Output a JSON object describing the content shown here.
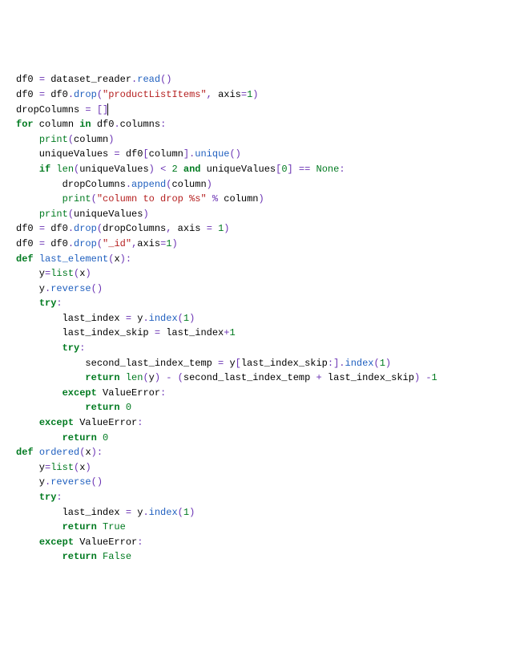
{
  "code": {
    "lines": [
      [
        [
          "nm",
          "df0 "
        ],
        [
          "op",
          "="
        ],
        [
          "nm",
          " dataset_reader"
        ],
        [
          "op",
          "."
        ],
        [
          "fn",
          "read"
        ],
        [
          "op",
          "()"
        ]
      ],
      [
        [
          "nm",
          "df0 "
        ],
        [
          "op",
          "="
        ],
        [
          "nm",
          " df0"
        ],
        [
          "op",
          "."
        ],
        [
          "fn",
          "drop"
        ],
        [
          "op",
          "("
        ],
        [
          "str",
          "\"productListItems\""
        ],
        [
          "op",
          ", "
        ],
        [
          "nm",
          "axis"
        ],
        [
          "op",
          "="
        ],
        [
          "num",
          "1"
        ],
        [
          "op",
          ")"
        ]
      ],
      [
        [
          "nm",
          "dropColumns "
        ],
        [
          "op",
          "="
        ],
        [
          "nm",
          " "
        ],
        [
          "op",
          "[]"
        ],
        [
          "cursor",
          ""
        ]
      ],
      [
        [
          "kw",
          "for"
        ],
        [
          "nm",
          " column "
        ],
        [
          "kw",
          "in"
        ],
        [
          "nm",
          " df0"
        ],
        [
          "op",
          "."
        ],
        [
          "nm",
          "columns"
        ],
        [
          "op",
          ":"
        ]
      ],
      [
        [
          "nm",
          "    "
        ],
        [
          "bi",
          "print"
        ],
        [
          "op",
          "("
        ],
        [
          "nm",
          "column"
        ],
        [
          "op",
          ")"
        ]
      ],
      [
        [
          "nm",
          "    uniqueValues "
        ],
        [
          "op",
          "="
        ],
        [
          "nm",
          " df0"
        ],
        [
          "op",
          "["
        ],
        [
          "nm",
          "column"
        ],
        [
          "op",
          "]."
        ],
        [
          "fn",
          "unique"
        ],
        [
          "op",
          "()"
        ]
      ],
      [
        [
          "nm",
          "    "
        ],
        [
          "kw",
          "if"
        ],
        [
          "nm",
          " "
        ],
        [
          "bi",
          "len"
        ],
        [
          "op",
          "("
        ],
        [
          "nm",
          "uniqueValues"
        ],
        [
          "op",
          ") "
        ],
        [
          "op",
          "<"
        ],
        [
          "nm",
          " "
        ],
        [
          "num",
          "2"
        ],
        [
          "nm",
          " "
        ],
        [
          "kw",
          "and"
        ],
        [
          "nm",
          " uniqueValues"
        ],
        [
          "op",
          "["
        ],
        [
          "num",
          "0"
        ],
        [
          "op",
          "] "
        ],
        [
          "op",
          "=="
        ],
        [
          "nm",
          " "
        ],
        [
          "bi",
          "None"
        ],
        [
          "op",
          ":"
        ]
      ],
      [
        [
          "nm",
          "        dropColumns"
        ],
        [
          "op",
          "."
        ],
        [
          "fn",
          "append"
        ],
        [
          "op",
          "("
        ],
        [
          "nm",
          "column"
        ],
        [
          "op",
          ")"
        ]
      ],
      [
        [
          "nm",
          "        "
        ],
        [
          "bi",
          "print"
        ],
        [
          "op",
          "("
        ],
        [
          "str",
          "\"column to drop %s\""
        ],
        [
          "nm",
          " "
        ],
        [
          "op",
          "%"
        ],
        [
          "nm",
          " column"
        ],
        [
          "op",
          ")"
        ]
      ],
      [
        [
          "nm",
          "    "
        ],
        [
          "bi",
          "print"
        ],
        [
          "op",
          "("
        ],
        [
          "nm",
          "uniqueValues"
        ],
        [
          "op",
          ")"
        ]
      ],
      [
        [
          "nm",
          "df0 "
        ],
        [
          "op",
          "="
        ],
        [
          "nm",
          " df0"
        ],
        [
          "op",
          "."
        ],
        [
          "fn",
          "drop"
        ],
        [
          "op",
          "("
        ],
        [
          "nm",
          "dropColumns"
        ],
        [
          "op",
          ", "
        ],
        [
          "nm",
          "axis "
        ],
        [
          "op",
          "="
        ],
        [
          "nm",
          " "
        ],
        [
          "num",
          "1"
        ],
        [
          "op",
          ")"
        ]
      ],
      [
        [
          "nm",
          "df0 "
        ],
        [
          "op",
          "="
        ],
        [
          "nm",
          " df0"
        ],
        [
          "op",
          "."
        ],
        [
          "fn",
          "drop"
        ],
        [
          "op",
          "("
        ],
        [
          "str",
          "\"_id\""
        ],
        [
          "op",
          ","
        ],
        [
          "nm",
          "axis"
        ],
        [
          "op",
          "="
        ],
        [
          "num",
          "1"
        ],
        [
          "op",
          ")"
        ]
      ],
      [
        [
          "kw",
          "def"
        ],
        [
          "nm",
          " "
        ],
        [
          "fn",
          "last_element"
        ],
        [
          "op",
          "("
        ],
        [
          "nm",
          "x"
        ],
        [
          "op",
          "):"
        ]
      ],
      [
        [
          "nm",
          "    y"
        ],
        [
          "op",
          "="
        ],
        [
          "bi",
          "list"
        ],
        [
          "op",
          "("
        ],
        [
          "nm",
          "x"
        ],
        [
          "op",
          ")"
        ]
      ],
      [
        [
          "nm",
          "    y"
        ],
        [
          "op",
          "."
        ],
        [
          "fn",
          "reverse"
        ],
        [
          "op",
          "()"
        ]
      ],
      [
        [
          "nm",
          "    "
        ],
        [
          "kw",
          "try"
        ],
        [
          "op",
          ":"
        ]
      ],
      [
        [
          "nm",
          "        last_index "
        ],
        [
          "op",
          "="
        ],
        [
          "nm",
          " y"
        ],
        [
          "op",
          "."
        ],
        [
          "fn",
          "index"
        ],
        [
          "op",
          "("
        ],
        [
          "num",
          "1"
        ],
        [
          "op",
          ")"
        ]
      ],
      [
        [
          "nm",
          "        last_index_skip "
        ],
        [
          "op",
          "="
        ],
        [
          "nm",
          " last_index"
        ],
        [
          "op",
          "+"
        ],
        [
          "num",
          "1"
        ]
      ],
      [
        [
          "nm",
          "        "
        ],
        [
          "kw",
          "try"
        ],
        [
          "op",
          ":"
        ]
      ],
      [
        [
          "nm",
          "            second_last_index_temp "
        ],
        [
          "op",
          "="
        ],
        [
          "nm",
          " y"
        ],
        [
          "op",
          "["
        ],
        [
          "nm",
          "last_index_skip"
        ],
        [
          "op",
          ":]."
        ],
        [
          "fn",
          "index"
        ],
        [
          "op",
          "("
        ],
        [
          "num",
          "1"
        ],
        [
          "op",
          ")"
        ]
      ],
      [
        [
          "nm",
          "            "
        ],
        [
          "kw",
          "return"
        ],
        [
          "nm",
          " "
        ],
        [
          "bi",
          "len"
        ],
        [
          "op",
          "("
        ],
        [
          "nm",
          "y"
        ],
        [
          "op",
          ") "
        ],
        [
          "op",
          "-"
        ],
        [
          "nm",
          " "
        ],
        [
          "op",
          "("
        ],
        [
          "nm",
          "second_last_index_temp "
        ],
        [
          "op",
          "+"
        ],
        [
          "nm",
          " last_index_skip"
        ],
        [
          "op",
          ") "
        ],
        [
          "op",
          "-"
        ],
        [
          "num",
          "1"
        ]
      ],
      [
        [
          "nm",
          "        "
        ],
        [
          "kw",
          "except"
        ],
        [
          "nm",
          " ValueError"
        ],
        [
          "op",
          ":"
        ]
      ],
      [
        [
          "nm",
          "            "
        ],
        [
          "kw",
          "return"
        ],
        [
          "nm",
          " "
        ],
        [
          "num",
          "0"
        ]
      ],
      [
        [
          "nm",
          "    "
        ],
        [
          "kw",
          "except"
        ],
        [
          "nm",
          " ValueError"
        ],
        [
          "op",
          ":"
        ]
      ],
      [
        [
          "nm",
          "        "
        ],
        [
          "kw",
          "return"
        ],
        [
          "nm",
          " "
        ],
        [
          "num",
          "0"
        ]
      ],
      [
        [
          "kw",
          "def"
        ],
        [
          "nm",
          " "
        ],
        [
          "fn",
          "ordered"
        ],
        [
          "op",
          "("
        ],
        [
          "nm",
          "x"
        ],
        [
          "op",
          "):"
        ]
      ],
      [
        [
          "nm",
          "    y"
        ],
        [
          "op",
          "="
        ],
        [
          "bi",
          "list"
        ],
        [
          "op",
          "("
        ],
        [
          "nm",
          "x"
        ],
        [
          "op",
          ")"
        ]
      ],
      [
        [
          "nm",
          "    y"
        ],
        [
          "op",
          "."
        ],
        [
          "fn",
          "reverse"
        ],
        [
          "op",
          "()"
        ]
      ],
      [
        [
          "nm",
          "    "
        ],
        [
          "kw",
          "try"
        ],
        [
          "op",
          ":"
        ]
      ],
      [
        [
          "nm",
          "        last_index "
        ],
        [
          "op",
          "="
        ],
        [
          "nm",
          " y"
        ],
        [
          "op",
          "."
        ],
        [
          "fn",
          "index"
        ],
        [
          "op",
          "("
        ],
        [
          "num",
          "1"
        ],
        [
          "op",
          ")"
        ]
      ],
      [
        [
          "nm",
          "        "
        ],
        [
          "kw",
          "return"
        ],
        [
          "nm",
          " "
        ],
        [
          "bi",
          "True"
        ]
      ],
      [
        [
          "nm",
          "    "
        ],
        [
          "kw",
          "except"
        ],
        [
          "nm",
          " ValueError"
        ],
        [
          "op",
          ":"
        ]
      ],
      [
        [
          "nm",
          "        "
        ],
        [
          "kw",
          "return"
        ],
        [
          "nm",
          " "
        ],
        [
          "bi",
          "False"
        ]
      ]
    ]
  }
}
